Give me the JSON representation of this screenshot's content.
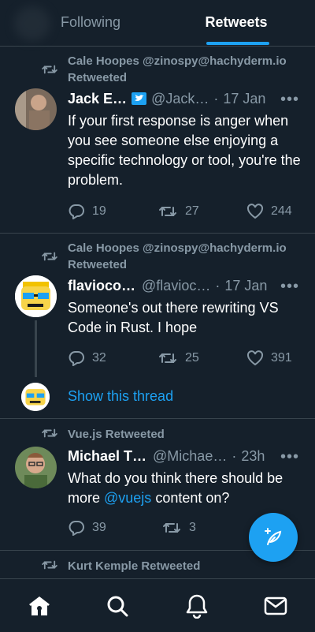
{
  "tabs": {
    "following": "Following",
    "retweets": "Retweets"
  },
  "tweets": [
    {
      "retweeter_line": "Cale Hoopes @zinospy@hachyderm.io",
      "retweeted_label": "Retweeted",
      "name": "Jack E…",
      "handle": "@Jack…",
      "dot": "·",
      "time": "17 Jan",
      "more": "•••",
      "text": "If your first response is anger when you see someone else enjoying a specific technology or tool, you're the problem.",
      "replies": "19",
      "retweets": "27",
      "likes": "244"
    },
    {
      "retweeter_line": "Cale Hoopes @zinospy@hachyderm.io",
      "retweeted_label": "Retweeted",
      "name": "flavioco…",
      "handle": "@flavioc…",
      "dot": "·",
      "time": "17 Jan",
      "more": "•••",
      "text": "Someone's out there rewriting VS Code in Rust. I hope",
      "replies": "32",
      "retweets": "25",
      "likes": "391",
      "show_thread": "Show this thread"
    },
    {
      "retweeter_line": "Vue.js Retweeted",
      "name": "Michael T…",
      "handle": "@Michae…",
      "dot": "·",
      "time": "23h",
      "more": "•••",
      "text_before": "What do you think there should be more ",
      "text_link": "@vuejs",
      "text_after": " content on?",
      "replies": "39",
      "retweets": "3"
    },
    {
      "retweeter_line": "Kurt Kemple Retweeted"
    }
  ],
  "colors": {
    "background": "#15202b",
    "accent": "#1da1f2",
    "muted": "#8899a6",
    "divider": "#38444d"
  },
  "icons": {
    "nav": [
      "home-icon",
      "search-icon",
      "bell-icon",
      "mail-icon"
    ],
    "fab": "compose-feather-icon"
  }
}
